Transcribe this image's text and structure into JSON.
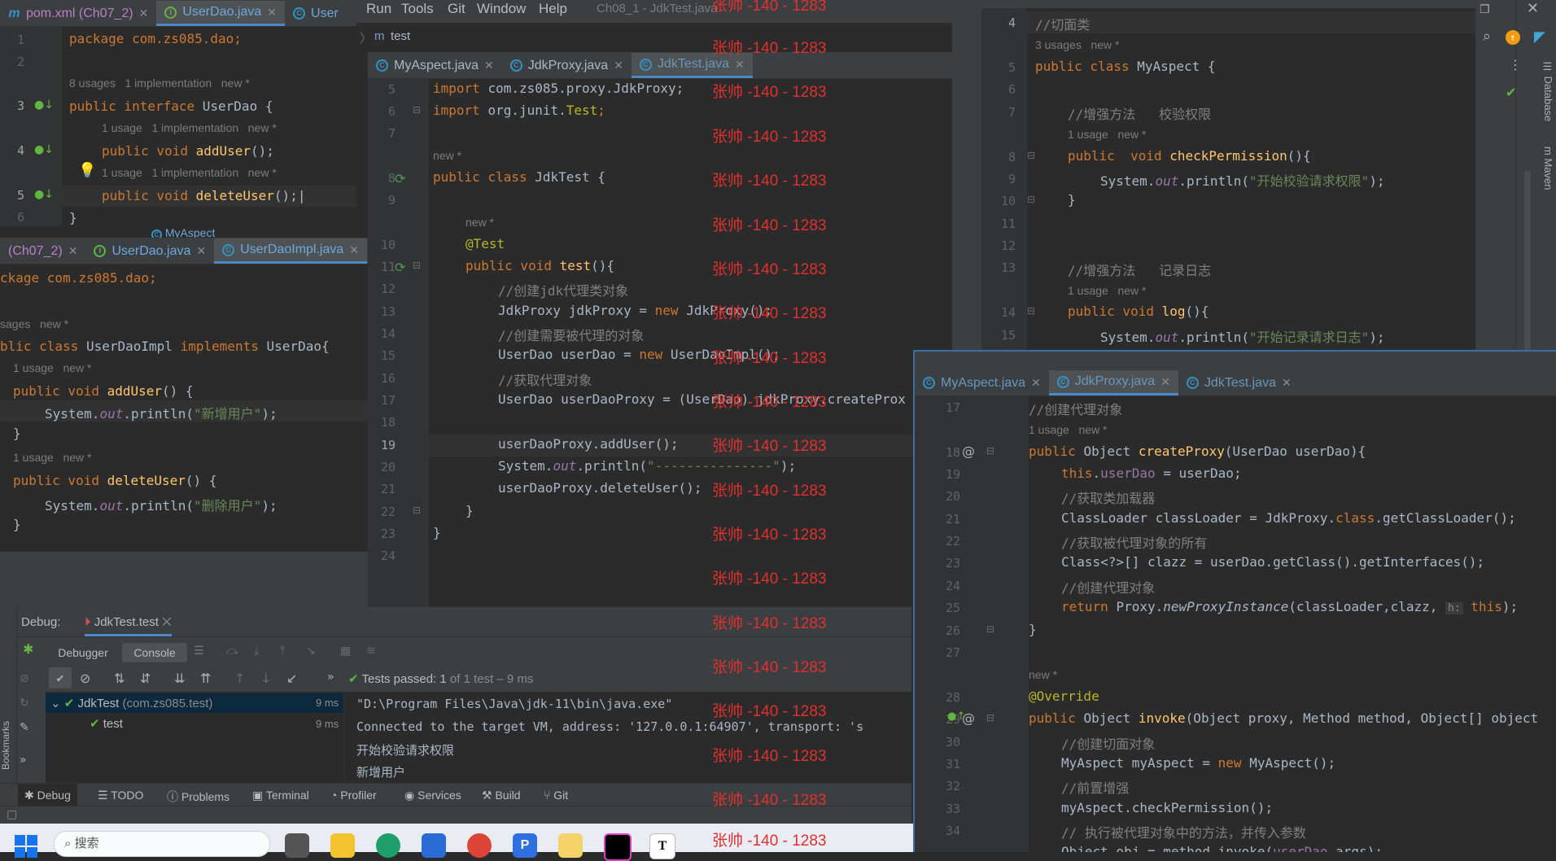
{
  "window": {
    "title": "Ch08_1 - JdkTest.java",
    "menu": [
      "Run",
      "Tools",
      "Git",
      "Window",
      "Help"
    ],
    "breadcrumb": "test"
  },
  "watermark": "张帅 -140 - 1283",
  "editors": {
    "userdao": {
      "tabs": [
        {
          "label": "pom.xml (Ch07_2)"
        },
        {
          "label": "UserDao.java"
        },
        {
          "label": "User"
        }
      ],
      "line_numbers": [
        "1",
        "2",
        "3",
        "4",
        "5",
        "6"
      ],
      "code": {
        "l1": "package com.zs085.dao;",
        "hint_a": "8 usages   1 implementation   new *",
        "l3a": "public interface ",
        "l3b": "UserDao {",
        "hint_b": "1 usage   1 implementation   new *",
        "l4a": "public void ",
        "l4b": "addUser",
        "l4c": "();",
        "hint_c": "1 usage   1 implementation   new *",
        "l5a": "public void ",
        "l5b": "deleteUser",
        "l5c": "();",
        "l6": "}"
      },
      "peek_label": "MyAspect"
    },
    "userdaoimpl": {
      "tabs": [
        {
          "label": "(Ch07_2)"
        },
        {
          "label": "UserDao.java"
        },
        {
          "label": "UserDaoImpl.java"
        }
      ],
      "code": {
        "l1": "ckage com.zs085.dao;",
        "hint_a": "sages   new *",
        "l3a": "blic class ",
        "l3b": "UserDaoImpl ",
        "l3c": "implements ",
        "l3d": "UserDao{",
        "hint_b": "1 usage   new *",
        "l4a": "public void ",
        "l4b": "addUser",
        "l4c": "() {",
        "l5a": "System.",
        "l5b": "out",
        "l5c": ".println(",
        "l5d": "\"新增用户\"",
        "l5e": ");",
        "l6": "}",
        "hint_c": "1 usage   new *",
        "l7a": "public void ",
        "l7b": "deleteUser",
        "l7c": "() {",
        "l8a": "System.",
        "l8b": "out",
        "l8c": ".println(",
        "l8d": "\"删除用户\"",
        "l8e": ");",
        "l9": "}"
      }
    },
    "jdktest": {
      "tabs": [
        {
          "label": "MyAspect.java"
        },
        {
          "label": "JdkProxy.java"
        },
        {
          "label": "JdkTest.java"
        }
      ],
      "line_numbers": [
        "5",
        "6",
        "7",
        "8",
        "9",
        "10",
        "11",
        "12",
        "13",
        "14",
        "15",
        "16",
        "17",
        "18",
        "19",
        "20",
        "21",
        "22",
        "23",
        "24"
      ],
      "code": {
        "l5a": "import ",
        "l5b": "com.zs085.proxy.JdkProxy;",
        "l6a": "import ",
        "l6b": "org.junit.",
        "l6c": "Test",
        "l6d": ";",
        "hint_a": "new *",
        "l8a": "public class ",
        "l8b": "JdkTest {",
        "hint_b": "new *",
        "l10": "@Test",
        "l11a": "public void ",
        "l11b": "test",
        "l11c": "(){",
        "l12": "//创建jdk代理类对象",
        "l13a": "JdkProxy jdkProxy = ",
        "l13b": "new ",
        "l13c": "JdkProxy();",
        "l14": "//创建需要被代理的对象",
        "l15a": "UserDao userDao = ",
        "l15b": "new ",
        "l15c": "UserDaoImpl();",
        "l16": "//获取代理对象",
        "l17": "UserDao userDaoProxy = (UserDao) jdkProxy.createProx",
        "l19": "userDaoProxy.addUser();",
        "l20a": "System.",
        "l20b": "out",
        "l20c": ".println(",
        "l20d": "\"---------------\"",
        "l20e": ");",
        "l21": "userDaoProxy.deleteUser();",
        "l22": "}",
        "l23": "}"
      }
    },
    "myaspect": {
      "line_numbers": [
        "4",
        "5",
        "6",
        "7",
        "8",
        "9",
        "10",
        "11",
        "12",
        "13",
        "14",
        "15"
      ],
      "code": {
        "l4": "//切面类",
        "hint_a": "3 usages   new *",
        "l5a": "public class ",
        "l5b": "MyAspect {",
        "l7": "//增强方法   校验权限",
        "hint_b": "1 usage   new *",
        "l8a": "public  void ",
        "l8b": "checkPermission",
        "l8c": "(){",
        "l9a": "System.",
        "l9b": "out",
        "l9c": ".println(",
        "l9d": "\"开始校验请求权限\"",
        "l9e": ");",
        "l10": "}",
        "l13": "//增强方法   记录日志",
        "hint_c": "1 usage   new *",
        "l14a": "public void ",
        "l14b": "log",
        "l14c": "(){",
        "l15a": "System.",
        "l15b": "out",
        "l15c": ".println(",
        "l15d": "\"开始记录请求日志\"",
        "l15e": ");"
      },
      "side_tools": [
        "Database",
        "Maven"
      ]
    },
    "jdkproxy": {
      "tabs": [
        {
          "label": "MyAspect.java"
        },
        {
          "label": "JdkProxy.java"
        },
        {
          "label": "JdkTest.java"
        }
      ],
      "line_numbers": [
        "17",
        "18",
        "19",
        "20",
        "21",
        "22",
        "23",
        "24",
        "25",
        "26",
        "27",
        "28",
        "29",
        "30",
        "31",
        "32",
        "33",
        "34"
      ],
      "code": {
        "l17": "//创建代理对象",
        "hint_a": "1 usage   new *",
        "l18a": "public ",
        "l18b": "Object ",
        "l18c": "createProxy",
        "l18d": "(UserDao userDao){",
        "l19a": "this",
        "l19b": ".",
        "l19c": "userDao",
        "l19d": " = userDao;",
        "l20": "//获取类加载器",
        "l21a": "ClassLoader classLoader = JdkProxy.",
        "l21b": "class",
        "l21c": ".getClassLoader();",
        "l22": "//获取被代理对象的所有",
        "l23": "Class<?>[] clazz = userDao.getClass().getInterfaces();",
        "l24": "//创建代理对象",
        "l25a": "return ",
        "l25b": "Proxy.",
        "l25c": "newProxyInstance",
        "l25d": "(classLoader,clazz, ",
        "l25e": "h:",
        "l25f": " this",
        "l25g": ");",
        "l26": "}",
        "hint_b": "new *",
        "l28": "@Override",
        "l29a": "public ",
        "l29b": "Object ",
        "l29c": "invoke",
        "l29d": "(Object proxy, Method method, Object[] object",
        "l30": "//创建切面对象",
        "l31a": "MyAspect myAspect = ",
        "l31b": "new ",
        "l31c": "MyAspect();",
        "l32": "//前置增强",
        "l33": "myAspect.checkPermission();",
        "l34": "// 执行被代理对象中的方法，并传入参数",
        "l35a": "Object obj = method.invoke(",
        "l35b": "userDao",
        "l35c": ",args);"
      }
    }
  },
  "debug": {
    "label": "Debug:",
    "config_tab": "JdkTest.test",
    "tabs": [
      "Debugger",
      "Console"
    ],
    "status_prefix": "Tests passed: ",
    "status_count": "1",
    "status_suffix": " of 1 test – 9 ms",
    "tree": [
      {
        "name": "JdkTest",
        "detail": "(com.zs085.test)",
        "time": "9 ms"
      },
      {
        "name": "test",
        "detail": "",
        "time": "9 ms"
      }
    ],
    "console_lines": [
      "\"D:\\Program Files\\Java\\jdk-11\\bin\\java.exe\"",
      "Connected to the target VM, address: '127.0.0.1:64907', transport: 's",
      "开始校验请求权限",
      "新增用户"
    ]
  },
  "bottom_tools": [
    "Debug",
    "TODO",
    "Problems",
    "Terminal",
    "Profiler",
    "Services",
    "Build",
    "Git"
  ],
  "left_strip": "Bookmarks",
  "taskbar": {
    "search_placeholder": "搜索"
  }
}
